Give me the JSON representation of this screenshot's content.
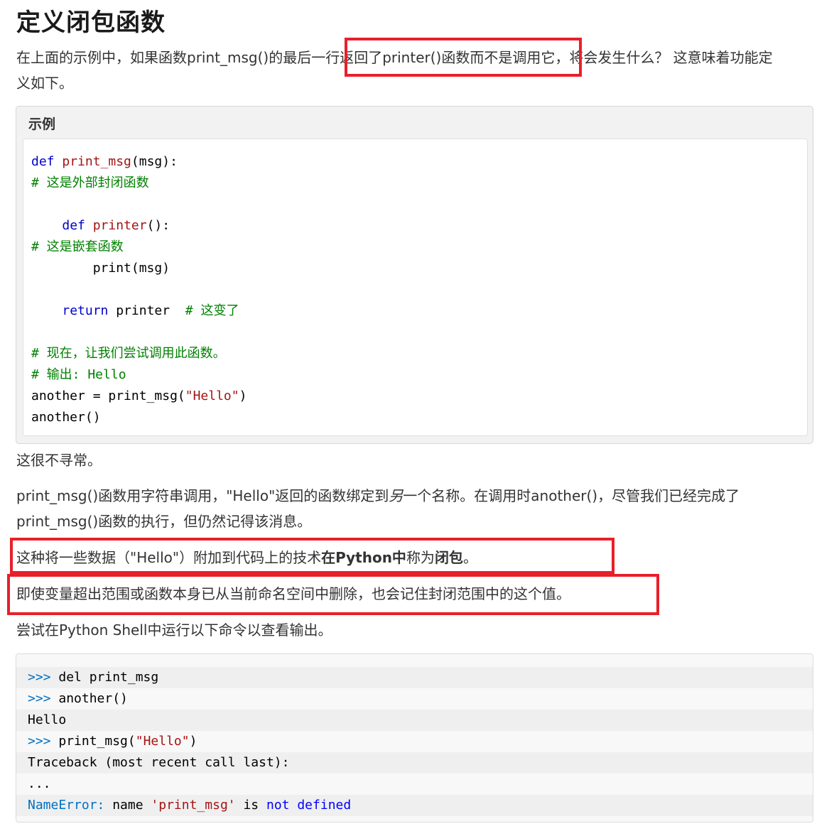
{
  "heading": "定义闭包函数",
  "intro": {
    "p1": "在上面的示例中，如果函数print_msg()的最后一行",
    "p2": "返回了printer()函数而不是调用它",
    "p3": "，将会发生什么？ 这意味着功能定",
    "line2": "义如下。"
  },
  "example": {
    "title": "示例",
    "code": {
      "l1_def": "def",
      "l1_name": "print_msg",
      "l1_rest": "(msg):",
      "l2_comment": "# 这是外部封闭函数",
      "l4_def": "def",
      "l4_name": "printer",
      "l4_rest": "():",
      "l5_comment": "# 这是嵌套函数",
      "l6": "print(msg)",
      "l8_return": "return",
      "l8_rest": " printer  ",
      "l8_comment": "# 这变了",
      "l10_comment": "# 现在，让我们尝试调用此函数。",
      "l11_comment": "# 输出: Hello",
      "l12_a": "another = print_msg(",
      "l12_str": "\"Hello\"",
      "l12_b": ")",
      "l13": "another()"
    }
  },
  "para_unusual": "这很不寻常。",
  "para_explain": {
    "a": "print_msg()函数用字符串调用，\"Hello\"返回的函数绑定到",
    "em": "另",
    "b": "一个名称。在调用时another()，尽管我们已经完成了",
    "line2": "print_msg()函数的执行，但仍然记得该消息。"
  },
  "para_closure": {
    "a": "这种将一些数据（\"Hello\"）附加到代码上的技术",
    "bold1": "在Python中",
    "b": "称为",
    "bold2": "闭包",
    "c": "。"
  },
  "para_remember": "即使变量超出范围或函数本身已从当前命名空间中删除，也会记住封闭范围中的这个值。",
  "para_try": "尝试在Python Shell中运行以下命令以查看输出。",
  "shell": {
    "prompt": ">>>",
    "l1": " del print_msg",
    "l2": " another()",
    "l3": "Hello",
    "l4_a": " print_msg(",
    "l4_str": "\"Hello\"",
    "l4_b": ")",
    "l5": "Traceback (most recent call last):",
    "l6": "...",
    "l7_err": "NameError:",
    "l7_a": " name ",
    "l7_str": "'print_msg'",
    "l7_b": " is ",
    "l7_not": "not",
    "l7_sp": " ",
    "l7_def": "defined"
  },
  "colors": {
    "highlight": "#e8202a",
    "keyword": "#0000cc",
    "string": "#a31515",
    "comment": "#008000",
    "prompt": "#0070c0"
  }
}
